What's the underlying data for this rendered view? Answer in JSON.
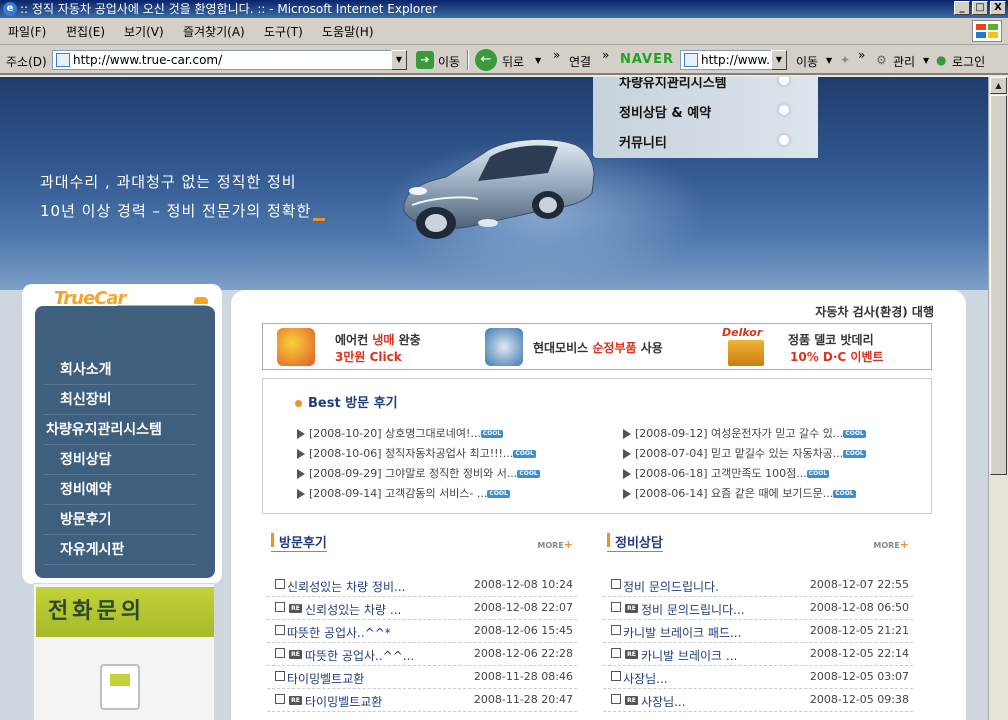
{
  "window": {
    "title": ":: 정직 자동차 공업사에 오신 것을 환영합니다. :: - Microsoft Internet Explorer",
    "min": "_",
    "max": "□",
    "close": "X"
  },
  "menu": [
    "파일(F)",
    "편집(E)",
    "보기(V)",
    "즐겨찾기(A)",
    "도구(T)",
    "도움말(H)"
  ],
  "address": {
    "label": "주소(D)",
    "url": "http://www.true-car.com/",
    "go": "이동",
    "back": "뒤로",
    "links": "연결",
    "naver": "NAVER",
    "naver_url": "http://www.",
    "naver_go": "이동",
    "manage": "관리",
    "login": "로그인",
    "chevrons": "»"
  },
  "hero": {
    "line1": "과대수리 , 과대청구 없는 정직한 정비",
    "line2": "10년 이상 경력 – 정비 전문가의 정확한",
    "menu": [
      "차량유지관리시스템",
      "정비상담 & 예약",
      "커뮤니티"
    ]
  },
  "sidebar": {
    "logo": "TrueCar",
    "nav": [
      "회사소개",
      "최신장비",
      "차량유지관리시스템",
      "정비상담",
      "정비예약",
      "방문후기",
      "자유게시판"
    ]
  },
  "phone": {
    "title": "전화문의"
  },
  "top_right": {
    "red": "자동차 검사(환경)",
    "gray": " 대행"
  },
  "promos": [
    {
      "line1_pre": "에어컨 ",
      "line1_red": "냉매",
      "line1_post": " 완충",
      "line2": "3만원  Click"
    },
    {
      "pre": "현대모비스 ",
      "red": "순정부품",
      "post": " 사용"
    },
    {
      "brand": "Delkor",
      "line1": "정품 델코 밧데리",
      "line2": "10%  D·C 이벤트"
    }
  ],
  "best": {
    "title": "Best 방문 후기",
    "cool": "COOL",
    "left": [
      "[2008-10-20] 상호명그대로네여!...",
      "[2008-10-06] 정직자동차공업사 최고!!!...",
      "[2008-09-29] 그야말로 정직한 정비와 서...",
      "[2008-09-14] 고객감동의 서비스- ..."
    ],
    "right": [
      "[2008-09-12] 여성운전자가 믿고 갈수 있...",
      "[2008-07-04] 믿고 맡길수 있는 자동차공...",
      "[2008-06-18] 고객만족도 100점...",
      "[2008-06-14] 요즘 같은 때에 보기드문..."
    ]
  },
  "reviews": {
    "title": "방문후기",
    "more": "MORE",
    "re": "RE",
    "items": [
      {
        "reply": false,
        "text": "신뢰성있는 차량 정비...",
        "date": "2008-12-08 10:24"
      },
      {
        "reply": true,
        "text": "신뢰성있는 차량 ...",
        "date": "2008-12-08 22:07"
      },
      {
        "reply": false,
        "text": "따뜻한 공업사..^^*",
        "date": "2008-12-06 15:45"
      },
      {
        "reply": true,
        "text": "따뜻한 공업사..^^...",
        "date": "2008-12-06 22:28"
      },
      {
        "reply": false,
        "text": "타이밍벨트교환",
        "date": "2008-11-28 08:46"
      },
      {
        "reply": true,
        "text": "타이밍벨트교환",
        "date": "2008-11-28 20:47"
      }
    ]
  },
  "consult": {
    "title": "정비상담",
    "more": "MORE",
    "re": "RE",
    "items": [
      {
        "reply": false,
        "text": "정비 문의드립니다.",
        "date": "2008-12-07 22:55"
      },
      {
        "reply": true,
        "text": "정비 문의드립니다...",
        "date": "2008-12-08 06:50"
      },
      {
        "reply": false,
        "text": "카니발 브레이크 패드...",
        "date": "2008-12-05 21:21"
      },
      {
        "reply": true,
        "text": "카니발 브레이크 ...",
        "date": "2008-12-05 22:14"
      },
      {
        "reply": false,
        "text": "사장님...",
        "date": "2008-12-05 03:07"
      },
      {
        "reply": true,
        "text": "사장님...",
        "date": "2008-12-05 09:38"
      }
    ]
  }
}
